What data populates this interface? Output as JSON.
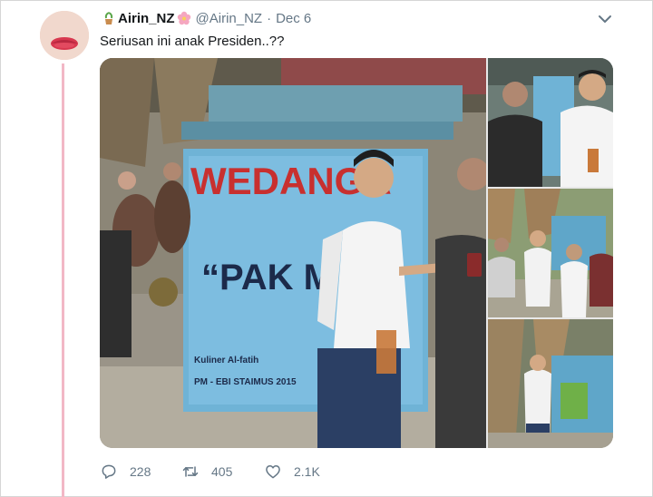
{
  "tweet": {
    "display_name": "Airin_NZ",
    "handle": "@Airin_NZ",
    "separator": "·",
    "date": "Dec 6",
    "text": "Seriusan ini anak Presiden..??",
    "name_emoji_left": "potted-plant-emoji",
    "name_emoji_right": "cherry-blossom-emoji"
  },
  "media": {
    "main_photo": {
      "sign_line1": "WEDANGA",
      "sign_line2": "“PAK M",
      "sign_footer1": "Kuliner Al-fatih",
      "sign_footer2": "PM - EBI STAIMUS 2015"
    }
  },
  "actions": {
    "reply_count": "228",
    "retweet_count": "405",
    "like_count": "2.1K"
  },
  "colors": {
    "thread_line": "#f2b8c6",
    "text_secondary": "#657786",
    "sign_blue": "#6fb3d6",
    "sign_red": "#c8302f"
  }
}
